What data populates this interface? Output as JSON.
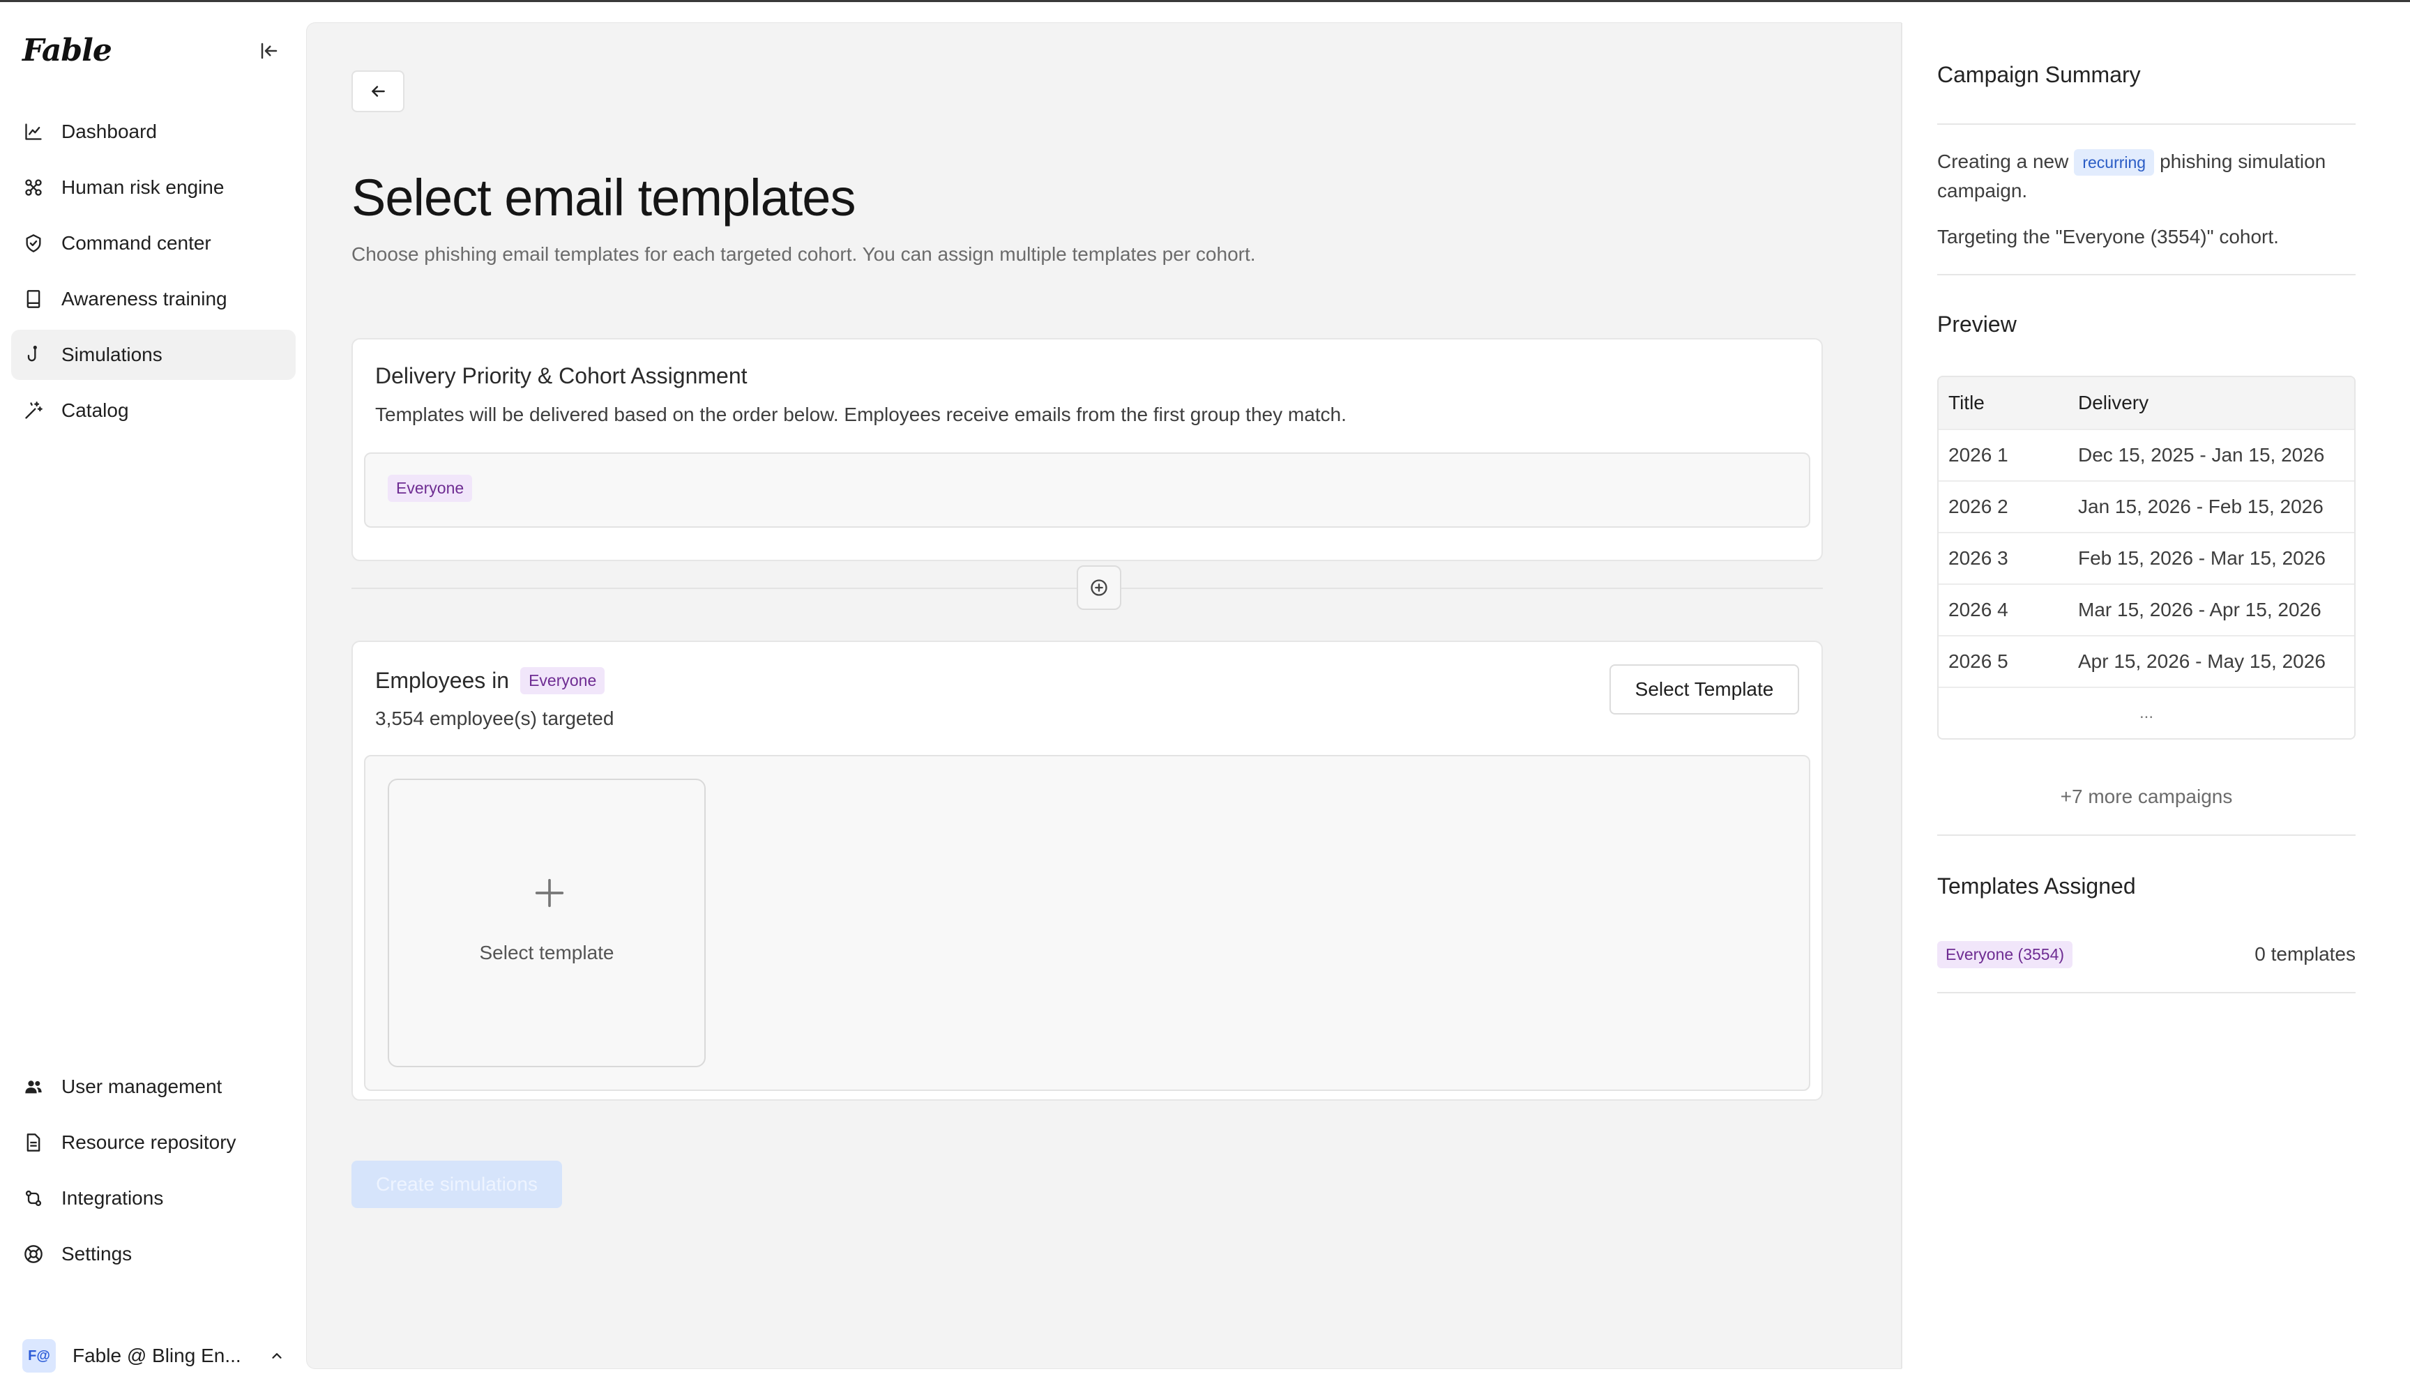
{
  "app": {
    "logo": "Fable"
  },
  "sidebar": {
    "items": [
      {
        "label": "Dashboard",
        "icon": "chart-line-icon"
      },
      {
        "label": "Human risk engine",
        "icon": "network-icon"
      },
      {
        "label": "Command center",
        "icon": "shield-check-icon"
      },
      {
        "label": "Awareness training",
        "icon": "book-icon"
      },
      {
        "label": "Simulations",
        "icon": "hook-icon",
        "active": true
      },
      {
        "label": "Catalog",
        "icon": "magic-wand-icon"
      }
    ],
    "bottom_items": [
      {
        "label": "User management",
        "icon": "users-icon"
      },
      {
        "label": "Resource repository",
        "icon": "document-icon"
      },
      {
        "label": "Integrations",
        "icon": "git-compare-icon"
      },
      {
        "label": "Settings",
        "icon": "lifebuoy-icon"
      }
    ],
    "account": {
      "initials": "F@",
      "name": "Fable @ Bling En..."
    }
  },
  "main": {
    "title": "Select email templates",
    "subtitle": "Choose phishing email templates for each targeted cohort. You can assign multiple templates per cohort.",
    "delivery": {
      "title": "Delivery Priority & Cohort Assignment",
      "description": "Templates will be delivered based on the order below. Employees receive emails from the first group they match.",
      "cohort": "Everyone"
    },
    "employees": {
      "title_prefix": "Employees in",
      "cohort": "Everyone",
      "count_text": "3,554 employee(s) targeted",
      "select_button": "Select Template",
      "tile_label": "Select template"
    },
    "create_button": "Create simulations"
  },
  "summary": {
    "title": "Campaign Summary",
    "creating_prefix": "Creating a new",
    "creating_badge": "recurring",
    "creating_suffix": "phishing simulation campaign.",
    "targeting": "Targeting the \"Everyone (3554)\" cohort.",
    "preview_title": "Preview",
    "table": {
      "headers": [
        "Title",
        "Delivery"
      ],
      "rows": [
        [
          "2026 1",
          "Dec 15, 2025 - Jan 15, 2026"
        ],
        [
          "2026 2",
          "Jan 15, 2026 - Feb 15, 2026"
        ],
        [
          "2026 3",
          "Feb 15, 2026 - Mar 15, 2026"
        ],
        [
          "2026 4",
          "Mar 15, 2026 - Apr 15, 2026"
        ],
        [
          "2026 5",
          "Apr 15, 2026 - May 15, 2026"
        ]
      ],
      "ellipsis": "..."
    },
    "more_campaigns": "+7 more campaigns",
    "assigned_title": "Templates Assigned",
    "assigned_cohort": "Everyone (3554)",
    "assigned_count": "0 templates"
  }
}
